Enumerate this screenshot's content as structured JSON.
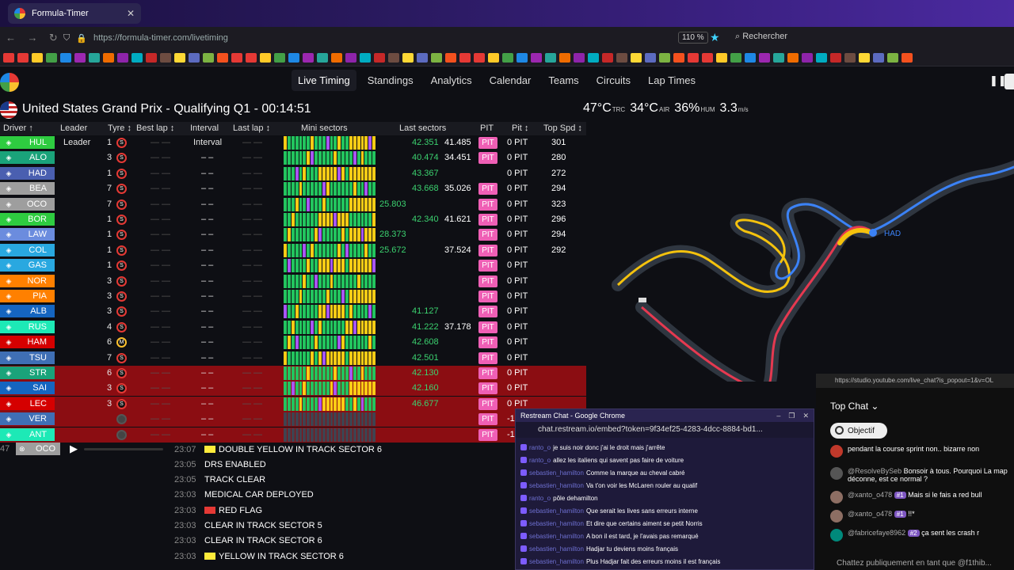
{
  "browser": {
    "tab_title": "Formula-Timer",
    "url": "https://formula-timer.com/livetiming",
    "zoom": "110 %",
    "search_label": "Rechercher"
  },
  "nav": {
    "items": [
      "Live Timing",
      "Standings",
      "Analytics",
      "Calendar",
      "Teams",
      "Circuits",
      "Lap Times"
    ]
  },
  "session": {
    "title": "United States Grand Prix - Qualifying Q1",
    "clock": "- 00:14:51",
    "weather": [
      {
        "value": "47°C",
        "unit": "TRC"
      },
      {
        "value": "34°C",
        "unit": "AIR"
      },
      {
        "value": "36%",
        "unit": "HUM"
      },
      {
        "value": "3.3",
        "unit": "m/s"
      }
    ]
  },
  "table": {
    "headers": [
      "Driver ↑",
      "Leader",
      "Tyre ↕",
      "Best lap ↕",
      "Interval",
      "Last lap ↕",
      "Mini sectors",
      "Last sectors",
      "PIT",
      "Pit ↕",
      "Top Spd ↕"
    ],
    "rows": [
      {
        "driver": "HUL",
        "color": "#2ecc40",
        "leader": "Leader",
        "laps": "1",
        "tyre": "S",
        "interval": "Interval",
        "s1": "42.351",
        "s2": "41.485",
        "pit": "PIT",
        "pitcount": "0 PIT",
        "spd": "301"
      },
      {
        "driver": "ALO",
        "color": "#1aa37a",
        "leader": "",
        "laps": "3",
        "tyre": "S",
        "interval": "– –",
        "s1": "40.474",
        "s2": "34.451",
        "pit": "PIT",
        "pitcount": "0 PIT",
        "spd": "280"
      },
      {
        "driver": "HAD",
        "color": "#4a5fb0",
        "leader": "",
        "laps": "1",
        "tyre": "S",
        "interval": "– –",
        "s1": "43.367",
        "s2": "",
        "pit": "",
        "pitcount": "0 PIT",
        "spd": "272"
      },
      {
        "driver": "BEA",
        "color": "#9e9e9e",
        "leader": "",
        "laps": "7",
        "tyre": "S",
        "interval": "– –",
        "s1": "43.668",
        "s2": "35.026",
        "pit": "PIT",
        "pitcount": "0 PIT",
        "spd": "294"
      },
      {
        "driver": "OCO",
        "color": "#9e9e9e",
        "leader": "",
        "laps": "7",
        "tyre": "S",
        "interval": "– –",
        "sp": "25.803",
        "s1": "",
        "s2": "",
        "pit": "PIT",
        "pitcount": "0 PIT",
        "spd": "323"
      },
      {
        "driver": "BOR",
        "color": "#2ecc40",
        "leader": "",
        "laps": "1",
        "tyre": "S",
        "interval": "– –",
        "s1": "42.340",
        "s2": "41.621",
        "pit": "PIT",
        "pitcount": "0 PIT",
        "spd": "296"
      },
      {
        "driver": "LAW",
        "color": "#6b8cde",
        "leader": "",
        "laps": "1",
        "tyre": "S",
        "interval": "– –",
        "sp": "28.373",
        "s1": "",
        "s2": "",
        "pit": "PIT",
        "pitcount": "0 PIT",
        "spd": "294"
      },
      {
        "driver": "COL",
        "color": "#29a8e0",
        "leader": "",
        "laps": "1",
        "tyre": "S",
        "interval": "– –",
        "sp": "25.672",
        "s1": "",
        "s2": "37.524",
        "pit": "PIT",
        "pitcount": "0 PIT",
        "spd": "292"
      },
      {
        "driver": "GAS",
        "color": "#29a8e0",
        "leader": "",
        "laps": "1",
        "tyre": "S",
        "interval": "– –",
        "s1": "",
        "s2": "",
        "pit": "PIT",
        "pitcount": "0 PIT",
        "spd": ""
      },
      {
        "driver": "NOR",
        "color": "#ff8000",
        "leader": "",
        "laps": "3",
        "tyre": "S",
        "interval": "– –",
        "s1": "",
        "s2": "",
        "pit": "PIT",
        "pitcount": "0 PIT",
        "spd": ""
      },
      {
        "driver": "PIA",
        "color": "#ff8000",
        "leader": "",
        "laps": "3",
        "tyre": "S",
        "interval": "– –",
        "s1": "",
        "s2": "",
        "pit": "PIT",
        "pitcount": "0 PIT",
        "spd": ""
      },
      {
        "driver": "ALB",
        "color": "#1565c0",
        "leader": "",
        "laps": "3",
        "tyre": "S",
        "interval": "– –",
        "s1": "41.127",
        "s2": "",
        "pit": "PIT",
        "pitcount": "0 PIT",
        "spd": ""
      },
      {
        "driver": "RUS",
        "color": "#1de9b6",
        "leader": "",
        "laps": "4",
        "tyre": "S",
        "interval": "– –",
        "s1": "41.222",
        "s2": "37.178",
        "pit": "PIT",
        "pitcount": "0 PIT",
        "spd": ""
      },
      {
        "driver": "HAM",
        "color": "#d50000",
        "leader": "",
        "laps": "6",
        "tyre": "M",
        "interval": "– –",
        "s1": "42.608",
        "s2": "",
        "pit": "PIT",
        "pitcount": "0 PIT",
        "spd": ""
      },
      {
        "driver": "TSU",
        "color": "#3f6fb5",
        "leader": "",
        "laps": "7",
        "tyre": "S",
        "interval": "– –",
        "s1": "42.501",
        "s2": "",
        "pit": "PIT",
        "pitcount": "0 PIT",
        "spd": ""
      },
      {
        "driver": "STR",
        "color": "#1aa37a",
        "leader": "",
        "laps": "6",
        "tyre": "S",
        "interval": "– –",
        "s1": "42.130",
        "s2": "",
        "pit": "PIT",
        "pitcount": "0 PIT",
        "spd": "",
        "out": true
      },
      {
        "driver": "SAI",
        "color": "#1565c0",
        "leader": "",
        "laps": "3",
        "tyre": "S",
        "interval": "– –",
        "s1": "42.160",
        "s2": "",
        "pit": "PIT",
        "pitcount": "0 PIT",
        "spd": "",
        "out": true
      },
      {
        "driver": "LEC",
        "color": "#d50000",
        "leader": "",
        "laps": "3",
        "tyre": "S",
        "interval": "– –",
        "s1": "46.677",
        "s2": "",
        "pit": "PIT",
        "pitcount": "0 PIT",
        "spd": "",
        "out": true
      },
      {
        "driver": "VER",
        "color": "#3f6fb5",
        "leader": "",
        "laps": "",
        "tyre": "",
        "interval": "– –",
        "s1": "",
        "s2": "",
        "pit": "PIT",
        "pitcount": "-1",
        "spd": "",
        "out": true
      },
      {
        "driver": "ANT",
        "color": "#1de9b6",
        "leader": "",
        "laps": "",
        "tyre": "",
        "interval": "– –",
        "s1": "",
        "s2": "",
        "pit": "PIT",
        "pitcount": "-1",
        "spd": "",
        "out": true
      }
    ]
  },
  "replay": {
    "driver": "OCO",
    "lap_prefix": "47"
  },
  "race_control": [
    {
      "time": "23:07",
      "flag": "#ffeb3b",
      "message": "DOUBLE YELLOW IN TRACK SECTOR 6"
    },
    {
      "time": "23:05",
      "flag": "",
      "message": "DRS ENABLED"
    },
    {
      "time": "23:05",
      "flag": "",
      "message": "TRACK CLEAR"
    },
    {
      "time": "23:03",
      "flag": "",
      "message": "MEDICAL CAR DEPLOYED"
    },
    {
      "time": "23:03",
      "flag": "#e53935",
      "message": "RED FLAG"
    },
    {
      "time": "23:03",
      "flag": "",
      "message": "CLEAR IN TRACK SECTOR 5"
    },
    {
      "time": "23:03",
      "flag": "",
      "message": "CLEAR IN TRACK SECTOR 6"
    },
    {
      "time": "23:03",
      "flag": "#ffeb3b",
      "message": "YELLOW IN TRACK SECTOR 6"
    }
  ],
  "map": {
    "car_label": "HAD"
  },
  "restream": {
    "title": "Restream Chat - Google Chrome",
    "url": "chat.restream.io/embed?token=9f34ef25-4283-4dcc-8884-bd1...",
    "messages": [
      {
        "user": "ranto_o",
        "text": "je suis noir donc j'ai le droit mais j'arrête"
      },
      {
        "user": "ranto_o",
        "text": "allez les italiens qui savent pas faire de voiture"
      },
      {
        "user": "sebastien_hamilton",
        "text": "Comme la marque au cheval cabré"
      },
      {
        "user": "sebastien_hamilton",
        "text": "Va t'on voir les McLaren rouler au qualif"
      },
      {
        "user": "ranto_o",
        "text": "pôle dehamilton"
      },
      {
        "user": "sebastien_hamilton",
        "text": "Que serait les lives sans erreurs interne"
      },
      {
        "user": "sebastien_hamilton",
        "text": "Et dire que certains aiment se petit Norris"
      },
      {
        "user": "sebastien_hamilton",
        "text": "A bon il est tard, je l'avais pas remarqué"
      },
      {
        "user": "sebastien_hamilton",
        "text": "Hadjar tu deviens moins français"
      },
      {
        "user": "sebastien_hamilton",
        "text": "Plus Hadjar fait des erreurs moins il est français"
      }
    ]
  },
  "ytchat": {
    "url": "https://studio.youtube.com/live_chat?is_popout=1&v=OL",
    "top_chat": "Top Chat",
    "objective": "Objectif",
    "messages": [
      {
        "avatar": "#c0392b",
        "user": "",
        "badge": "",
        "text": "pendant la course sprint non.. bizarre non"
      },
      {
        "avatar": "#555555",
        "user": "@ResolveBySeb",
        "badge": "",
        "text": "Bonsoir à tous. Pourquoi La map déconne, est ce normal ?"
      },
      {
        "avatar": "#8d6e63",
        "user": "@xanto_o478",
        "badge": "#1",
        "text": "Mais si le fais a red bull"
      },
      {
        "avatar": "#8d6e63",
        "user": "@xanto_o478",
        "badge": "#1",
        "text": "!!*"
      },
      {
        "avatar": "#00897b",
        "user": "@fabricefaye8962",
        "badge": "#2",
        "text": "ça sent les crash r"
      }
    ],
    "input_placeholder": "Chattez publiquement en tant que @f1thib..."
  }
}
